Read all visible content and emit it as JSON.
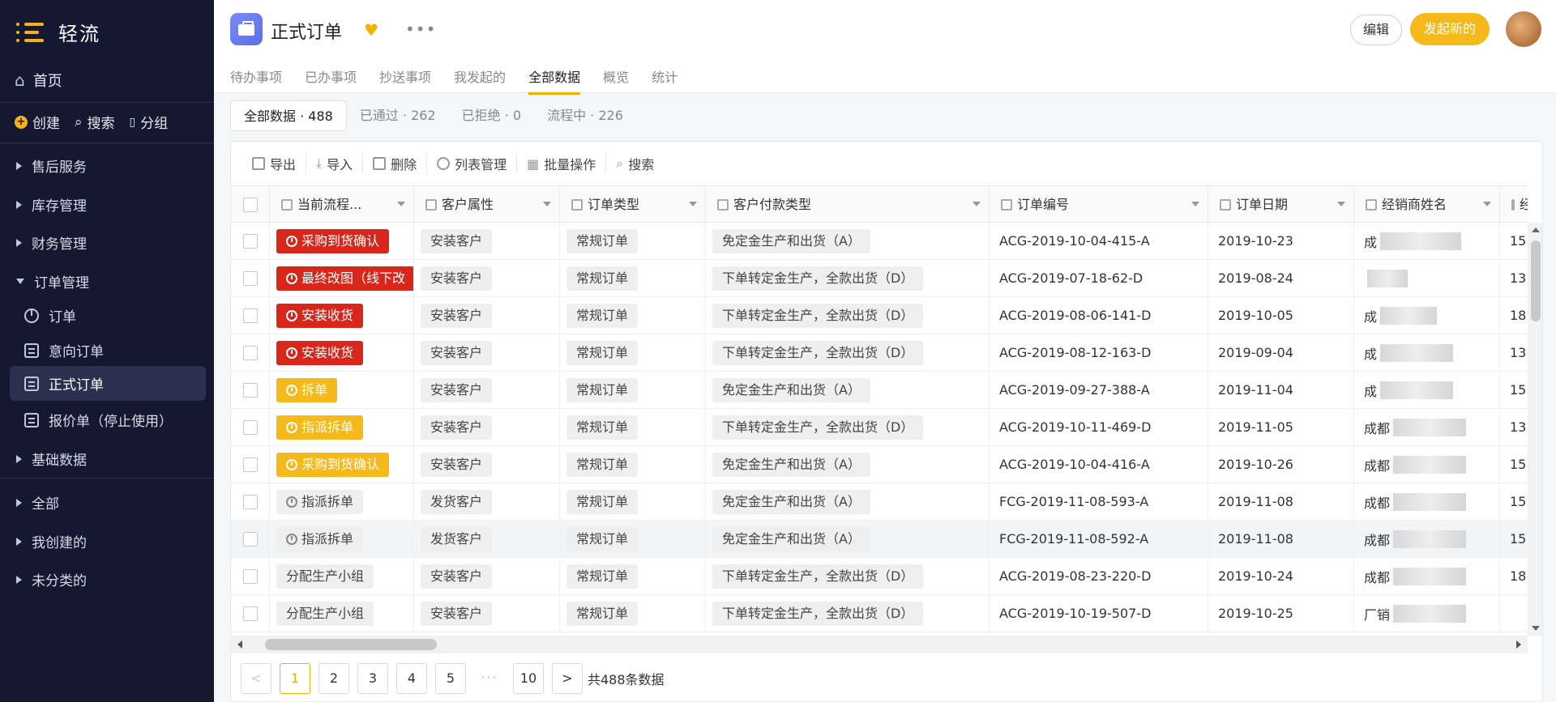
{
  "app": {
    "name": "轻流"
  },
  "sidebar": {
    "home": "首页",
    "quick": [
      "创建",
      "搜索",
      "分组"
    ],
    "groups_top": [
      "售后服务",
      "库存管理",
      "财务管理"
    ],
    "order_group": "订单管理",
    "order_items": [
      {
        "label": "订单",
        "icon": "pie-icon"
      },
      {
        "label": "意向订单",
        "icon": "doc-icon"
      },
      {
        "label": "正式订单",
        "icon": "doc-icon",
        "active": true
      },
      {
        "label": "报价单（停止使用）",
        "icon": "doc-icon"
      }
    ],
    "basic": "基础数据",
    "groups_bottom": [
      "全部",
      "我创建的",
      "未分类的"
    ]
  },
  "header": {
    "title": "正式订单",
    "edit": "编辑",
    "new": "发起新的",
    "tabs": [
      "待办事项",
      "已办事项",
      "抄送事项",
      "我发起的",
      "全部数据",
      "概览",
      "统计"
    ],
    "active_tab": "全部数据"
  },
  "filters": [
    "全部数据 · 488",
    "已通过 · 262",
    "已拒绝 · 0",
    "流程中 · 226"
  ],
  "toolbar": [
    "导出",
    "导入",
    "删除",
    "列表管理",
    "批量操作",
    "搜索"
  ],
  "columns": [
    "当前流程...",
    "客户属性",
    "订单类型",
    "客户付款类型",
    "订单编号",
    "订单日期",
    "经销商姓名",
    "经"
  ],
  "rows": [
    {
      "flow": "采购到货确认",
      "flow_style": "red",
      "attr": "安装客户",
      "type": "常规订单",
      "pay": "免定金生产和出货（A）",
      "no": "ACG-2019-10-04-415-A",
      "date": "2019-10-23",
      "dealer": "成",
      "extra": "15"
    },
    {
      "flow": "最终改图（线下改",
      "flow_style": "red",
      "attr": "安装客户",
      "type": "常规订单",
      "pay": "下单转定金生产，全款出货（D）",
      "no": "ACG-2019-07-18-62-D",
      "date": "2019-08-24",
      "dealer": "",
      "extra": "13"
    },
    {
      "flow": "安装收货",
      "flow_style": "red",
      "attr": "安装客户",
      "type": "常规订单",
      "pay": "下单转定金生产，全款出货（D）",
      "no": "ACG-2019-08-06-141-D",
      "date": "2019-10-05",
      "dealer": "成",
      "extra": "18"
    },
    {
      "flow": "安装收货",
      "flow_style": "red",
      "attr": "安装客户",
      "type": "常规订单",
      "pay": "下单转定金生产，全款出货（D）",
      "no": "ACG-2019-08-12-163-D",
      "date": "2019-09-04",
      "dealer": "成",
      "extra": "13"
    },
    {
      "flow": "拆单",
      "flow_style": "yellow",
      "attr": "安装客户",
      "type": "常规订单",
      "pay": "免定金生产和出货（A）",
      "no": "ACG-2019-09-27-388-A",
      "date": "2019-11-04",
      "dealer": "成",
      "extra": "15"
    },
    {
      "flow": "指派拆单",
      "flow_style": "yellow",
      "attr": "安装客户",
      "type": "常规订单",
      "pay": "下单转定金生产，全款出货（D）",
      "no": "ACG-2019-10-11-469-D",
      "date": "2019-11-05",
      "dealer": "成都",
      "extra": "13"
    },
    {
      "flow": "采购到货确认",
      "flow_style": "yellow",
      "attr": "安装客户",
      "type": "常规订单",
      "pay": "免定金生产和出货（A）",
      "no": "ACG-2019-10-04-416-A",
      "date": "2019-10-26",
      "dealer": "成都",
      "extra": "15"
    },
    {
      "flow": "指派拆单",
      "flow_style": "gray",
      "attr": "发货客户",
      "type": "常规订单",
      "pay": "免定金生产和出货（A）",
      "no": "FCG-2019-11-08-593-A",
      "date": "2019-11-08",
      "dealer": "成都",
      "extra": "15"
    },
    {
      "flow": "指派拆单",
      "flow_style": "gray",
      "attr": "发货客户",
      "type": "常规订单",
      "pay": "免定金生产和出货（A）",
      "no": "FCG-2019-11-08-592-A",
      "date": "2019-11-08",
      "dealer": "成都",
      "extra": "15"
    },
    {
      "flow": "分配生产小组",
      "flow_style": "plain",
      "attr": "安装客户",
      "type": "常规订单",
      "pay": "下单转定金生产，全款出货（D）",
      "no": "ACG-2019-08-23-220-D",
      "date": "2019-10-24",
      "dealer": "成都",
      "extra": "18"
    },
    {
      "flow": "分配生产小组",
      "flow_style": "plain",
      "attr": "安装客户",
      "type": "常规订单",
      "pay": "下单转定金生产，全款出货（D）",
      "no": "ACG-2019-10-19-507-D",
      "date": "2019-10-25",
      "dealer": "厂销",
      "extra": ""
    }
  ],
  "pager": {
    "pages": [
      "1",
      "2",
      "3",
      "4",
      "5",
      "10"
    ],
    "prev": "<",
    "next": ">",
    "dots": "···",
    "total": "共488条数据"
  },
  "colors": {
    "sidebar": "#141831",
    "accent": "#f6b91b",
    "danger": "#d8261b"
  }
}
